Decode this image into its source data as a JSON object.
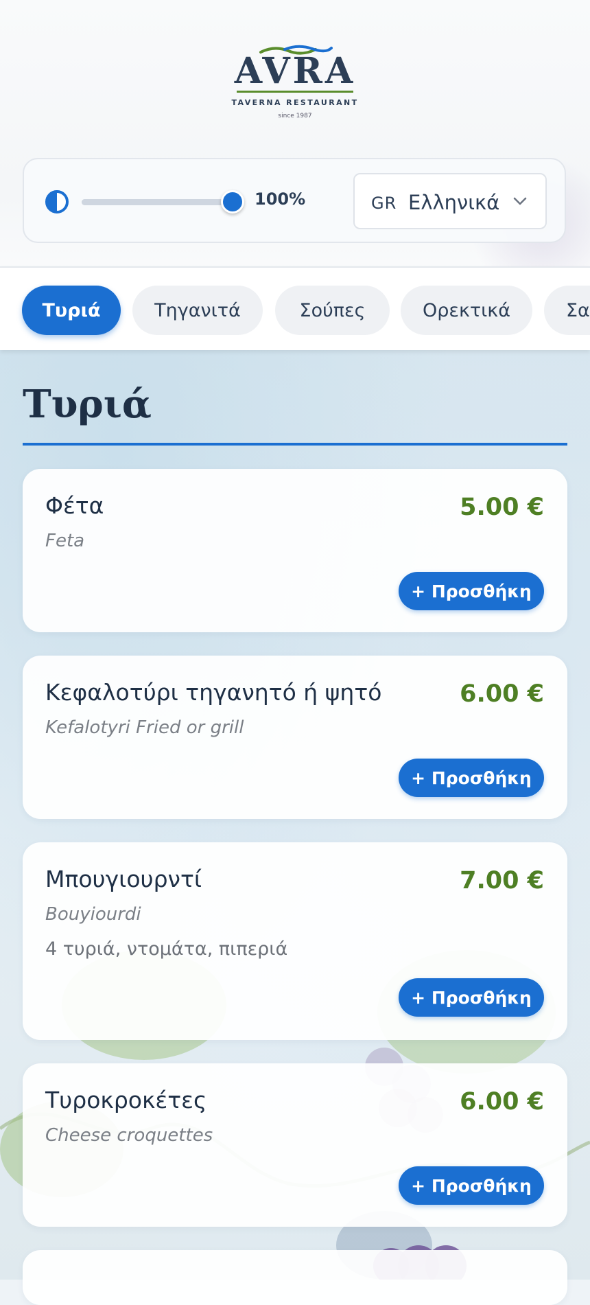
{
  "brand": {
    "name": "AVRA",
    "tagline": "TAVERNA RESTAURANT",
    "since": "since 1987"
  },
  "controls": {
    "contrast_value": "100%",
    "contrast_level": 1.0,
    "language_code": "GR",
    "language_name": "Ελληνικά"
  },
  "categories": [
    {
      "label": "Τυριά",
      "active": true
    },
    {
      "label": "Τηγανιτά",
      "active": false
    },
    {
      "label": "Σούπες",
      "active": false
    },
    {
      "label": "Ορεκτικά",
      "active": false
    },
    {
      "label": "Σα",
      "active": false
    }
  ],
  "section": {
    "title": "Τυριά"
  },
  "items": [
    {
      "name": "Φέτα",
      "subtitle": "Feta",
      "description": "",
      "price": "5.00 €",
      "add_label": "+ Προσθήκη"
    },
    {
      "name": "Κεφαλοτύρι τηγανητό ή ψητό",
      "subtitle": "Kefalotyri Fried or grill",
      "description": "",
      "price": "6.00 €",
      "add_label": "+ Προσθήκη"
    },
    {
      "name": "Μπουγιουρντί",
      "subtitle": "Bouyiourdi",
      "description": "4 τυριά, ντομάτα, πιπεριά",
      "price": "7.00 €",
      "add_label": "+ Προσθήκη"
    },
    {
      "name": "Τυροκροκέτες",
      "subtitle": "Cheese croquettes",
      "description": "",
      "price": "6.00 €",
      "add_label": "+ Προσθήκη"
    }
  ],
  "colors": {
    "accent": "#1b6fd1",
    "price": "#4e7f24",
    "text": "#1e2f45"
  }
}
